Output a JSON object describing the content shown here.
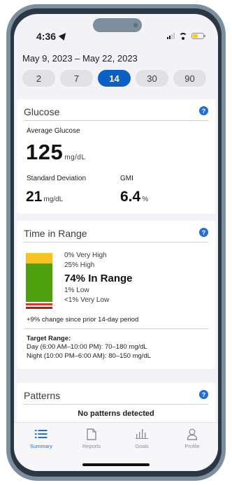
{
  "status_bar": {
    "time": "4:36"
  },
  "date_range": "May 9, 2023 – May 22, 2023",
  "day_ranges": [
    {
      "label": "2",
      "active": false
    },
    {
      "label": "7",
      "active": false
    },
    {
      "label": "14",
      "active": true
    },
    {
      "label": "30",
      "active": false
    },
    {
      "label": "90",
      "active": false
    }
  ],
  "glucose": {
    "title": "Glucose",
    "help": "?",
    "avg_label": "Average Glucose",
    "avg_value": "125",
    "avg_unit": "mg/dL",
    "sd_label": "Standard Deviation",
    "sd_value": "21",
    "sd_unit": "mg/dL",
    "gmi_label": "GMI",
    "gmi_value": "6.4",
    "gmi_unit": "%"
  },
  "time_in_range": {
    "title": "Time in Range",
    "help": "?",
    "very_high": "0% Very High",
    "high": "25% High",
    "in_range": "74% In Range",
    "low": "1% Low",
    "very_low": "<1% Very Low",
    "change": "+9% change since prior 14-day period",
    "target_heading": "Target Range:",
    "target_day": "Day (6:00 AM–10:00 PM): 70–180 mg/dL",
    "target_night": "Night (10:00 PM–6:00 AM): 80–150 mg/dL",
    "bar_percent": {
      "very_high": 0,
      "high": 25,
      "in_range": 74,
      "low": 1,
      "very_low": 0.5
    },
    "colors": {
      "high": "#f6c325",
      "in_range": "#4ea00f",
      "low": "#d83a2c",
      "very_low": "#b01e14"
    }
  },
  "patterns": {
    "title": "Patterns",
    "help": "?",
    "message": "No patterns detected"
  },
  "tabs": [
    {
      "label": "Summary",
      "icon": "list-icon",
      "active": true
    },
    {
      "label": "Reports",
      "icon": "document-icon",
      "active": false
    },
    {
      "label": "Goals",
      "icon": "bar-chart-icon",
      "active": false
    },
    {
      "label": "Profile",
      "icon": "person-icon",
      "active": false
    }
  ],
  "colors": {
    "accent": "#0a60c4"
  }
}
